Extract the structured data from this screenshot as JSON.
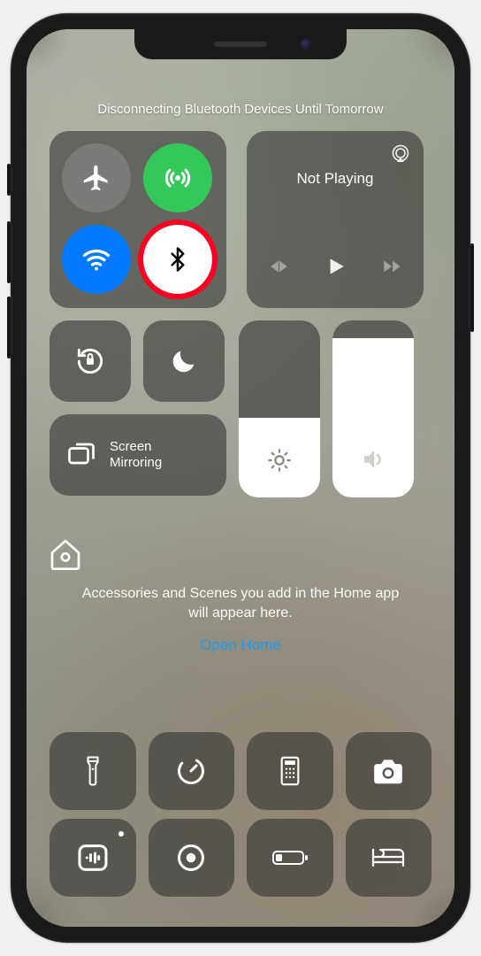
{
  "banner": "Disconnecting Bluetooth Devices Until Tomorrow",
  "connectivity": {
    "airplane_on": false,
    "cellular_on": true,
    "wifi_on": true,
    "bluetooth_highlight": true
  },
  "media": {
    "title": "Not Playing"
  },
  "mirror": {
    "label_line1": "Screen",
    "label_line2": "Mirroring"
  },
  "brightness_pct": 45,
  "volume_pct": 90,
  "home": {
    "message": "Accessories and Scenes you add in the Home app will appear here.",
    "link": "Open Home"
  }
}
